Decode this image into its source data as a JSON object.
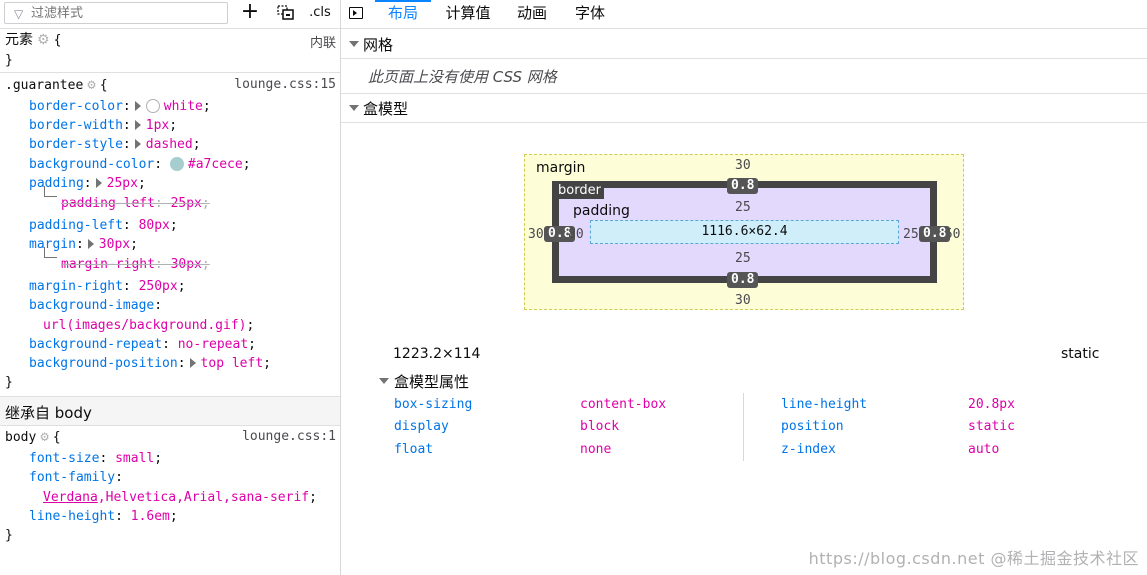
{
  "toolbar": {
    "filter_placeholder": "过滤样式",
    "add_rule_icon": "+",
    "print_simulation_icon": "⧉",
    "cls_label": ".cls"
  },
  "rules": {
    "element": {
      "selector": "元素",
      "open": "{",
      "close": "}",
      "source": "内联"
    },
    "guarantee": {
      "selector": ".guarantee",
      "source": "lounge.css:15",
      "open": "{",
      "close": "}",
      "decls": [
        {
          "prop": "border-color",
          "value": "white",
          "swatch": "#ffffff",
          "expand": true
        },
        {
          "prop": "border-width",
          "value": "1px",
          "expand": true
        },
        {
          "prop": "border-style",
          "value": "dashed",
          "expand": true
        },
        {
          "prop": "background-color",
          "value": "#a7cece",
          "swatch": "#a7cece"
        },
        {
          "prop": "padding",
          "value": "25px",
          "expand": true
        },
        {
          "prop": "padding-left",
          "value": "25px",
          "overridden": true
        },
        {
          "prop": "padding-left",
          "value": "80px"
        },
        {
          "prop": "margin",
          "value": "30px",
          "expand": true
        },
        {
          "prop": "margin-right",
          "value": "30px",
          "overridden": true
        },
        {
          "prop": "margin-right",
          "value": "250px"
        },
        {
          "prop": "background-image",
          "value": ""
        },
        {
          "prop": "",
          "value": "url(images/background.gif)"
        },
        {
          "prop": "background-repeat",
          "value": "no-repeat"
        },
        {
          "prop": "background-position",
          "value": "top left",
          "expand": true
        }
      ]
    },
    "inherited_header": "继承自 body",
    "body": {
      "selector": "body",
      "source": "lounge.css:1",
      "open": "{",
      "close": "}",
      "decls": [
        {
          "prop": "font-size",
          "value": "small"
        },
        {
          "prop": "font-family",
          "value": ""
        },
        {
          "prop": "",
          "value_first": "Verdana",
          "value_rest": ",Helvetica,Arial,sana-serif"
        },
        {
          "prop": "line-height",
          "value": "1.6em"
        }
      ]
    }
  },
  "tabs": [
    "布局",
    "计算值",
    "动画",
    "字体"
  ],
  "active_tab": 0,
  "grid": {
    "header": "网格",
    "message": "此页面上没有使用 CSS 网格"
  },
  "box_model": {
    "header": "盒模型",
    "margin_label": "margin",
    "border_label": "border",
    "padding_label": "padding",
    "margin": {
      "top": "30",
      "bottom": "30",
      "left": "30",
      "right": "250"
    },
    "border": {
      "top": "0.8",
      "bottom": "0.8",
      "left": "0.8",
      "right": "0.8"
    },
    "padding": {
      "top": "25",
      "bottom": "25",
      "left": "80",
      "right": "25"
    },
    "content_size": "1116.6×62.4",
    "element_size": "1223.2×114",
    "position": "static"
  },
  "box_props": {
    "header": "盒模型属性",
    "left": [
      {
        "name": "box-sizing",
        "value": "content-box"
      },
      {
        "name": "display",
        "value": "block"
      },
      {
        "name": "float",
        "value": "none"
      }
    ],
    "right": [
      {
        "name": "line-height",
        "value": "20.8px"
      },
      {
        "name": "position",
        "value": "static"
      },
      {
        "name": "z-index",
        "value": "auto"
      }
    ]
  },
  "watermark": "https://blog.csdn.net  @稀土掘金技术社区",
  "colors": {
    "accent": "#0a84ff",
    "property": "#0074e8",
    "value": "#dd00a9"
  }
}
